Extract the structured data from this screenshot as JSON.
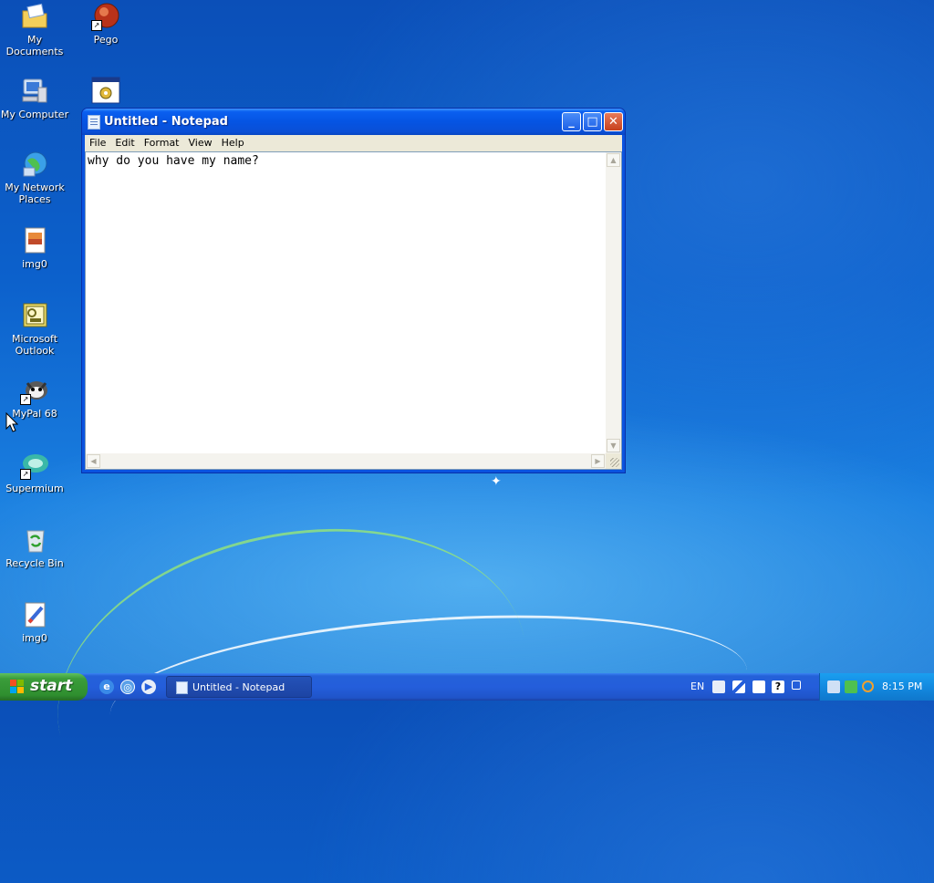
{
  "desktop": {
    "icons": [
      {
        "label": "My Documents",
        "icon": "my-documents-icon"
      },
      {
        "label": "Pego",
        "icon": "pego-icon"
      },
      {
        "label": "My Computer",
        "icon": "my-computer-icon"
      },
      {
        "label": "",
        "icon": "program-window-icon"
      },
      {
        "label": "My Network Places",
        "icon": "network-places-icon"
      },
      {
        "label": "img0",
        "icon": "image-file-icon"
      },
      {
        "label": "Microsoft Outlook",
        "icon": "outlook-icon"
      },
      {
        "label": "MyPal 68",
        "icon": "mypal-icon"
      },
      {
        "label": "Supermium",
        "icon": "supermium-icon"
      },
      {
        "label": "Recycle Bin",
        "icon": "recycle-bin-icon"
      },
      {
        "label": "img0",
        "icon": "paint-image-icon"
      }
    ]
  },
  "notepad": {
    "title": "Untitled - Notepad",
    "menu": [
      "File",
      "Edit",
      "Format",
      "View",
      "Help"
    ],
    "text": "why do you have my name?",
    "buttons": {
      "minimize": "_",
      "maximize": "□",
      "close": "✕"
    }
  },
  "taskbar": {
    "start_label": "start",
    "task_button_label": "Untitled - Notepad",
    "language": "EN",
    "clock": "8:15 PM",
    "quick_launch": [
      "internet-explorer-icon",
      "browser-icon",
      "media-player-icon"
    ]
  },
  "colors": {
    "title_bar": "#0554e3",
    "start_button": "#3b9d3b",
    "taskbar": "#245edb",
    "close_button": "#c7401d"
  }
}
